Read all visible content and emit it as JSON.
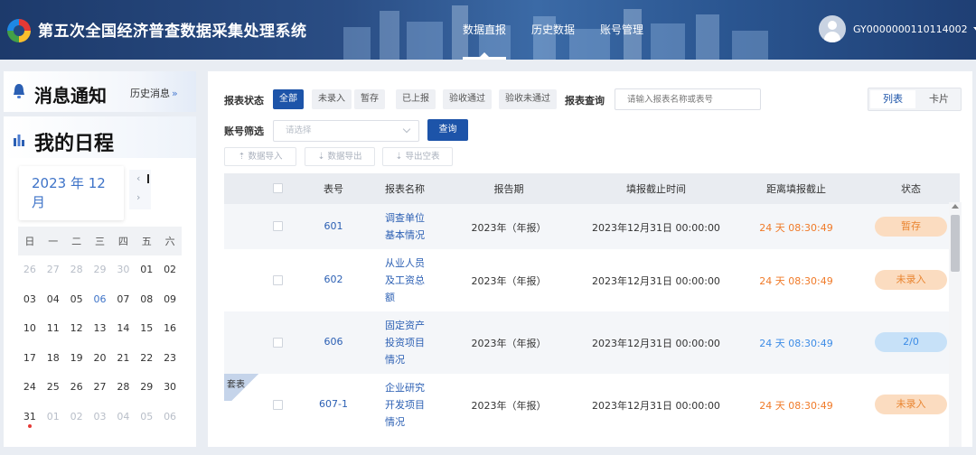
{
  "header": {
    "app_title": "第五次全国经济普查数据采集处理系统",
    "nav": [
      "数据直报",
      "历史数据",
      "账号管理"
    ],
    "active_nav": "数据直报",
    "username": "GY0000000110114002"
  },
  "sidebar": {
    "messages_title": "消息通知",
    "history_link": "历史消息",
    "schedule_title": "我的日程",
    "month_label": "2023 年 12 月",
    "weekdays": [
      "日",
      "一",
      "二",
      "三",
      "四",
      "五",
      "六"
    ],
    "weeks": [
      [
        "26",
        "27",
        "28",
        "29",
        "30",
        "01",
        "02"
      ],
      [
        "03",
        "04",
        "05",
        "06",
        "07",
        "08",
        "09"
      ],
      [
        "10",
        "11",
        "12",
        "13",
        "14",
        "15",
        "16"
      ],
      [
        "17",
        "18",
        "19",
        "20",
        "21",
        "22",
        "23"
      ],
      [
        "24",
        "25",
        "26",
        "27",
        "28",
        "29",
        "30"
      ],
      [
        "31",
        "01",
        "02",
        "03",
        "04",
        "05",
        "06"
      ]
    ],
    "today": "06",
    "event_day": "31"
  },
  "filters": {
    "status_label": "报表状态",
    "status_options": [
      "全部",
      "未录入",
      "暂存",
      "已上报",
      "验收通过",
      "验收未通过"
    ],
    "active_status": "全部",
    "query_label": "报表查询",
    "query_placeholder": "请输入报表名称或表号",
    "view_options": [
      "列表",
      "卡片"
    ],
    "account_label": "账号筛选",
    "account_placeholder": "请选择",
    "query_button": "查询",
    "actions": [
      "数据导入",
      "数据导出",
      "导出空表"
    ]
  },
  "table": {
    "columns": [
      "表号",
      "报表名称",
      "报告期",
      "填报截止时间",
      "距离填报截止",
      "状态"
    ],
    "rows": [
      {
        "code": "601",
        "name_lines": [
          "调查单位",
          "基本情况"
        ],
        "period": "2023年（年报）",
        "deadline": "2023年12月31日 00:00:00",
        "remaining": "24 天 08:30:49",
        "status": "暂存"
      },
      {
        "code": "602",
        "name_lines": [
          "从业人员",
          "及工资总",
          "额"
        ],
        "period": "2023年（年报）",
        "deadline": "2023年12月31日 00:00:00",
        "remaining": "24 天 08:30:49",
        "status": "未录入"
      },
      {
        "code": "606",
        "name_lines": [
          "固定资产",
          "投资项目",
          "情况"
        ],
        "period": "2023年（年报）",
        "deadline": "2023年12月31日 00:00:00",
        "remaining": "24 天 08:30:49",
        "status": "2/0"
      },
      {
        "code": "607-1",
        "name_lines": [
          "企业研究",
          "开发项目",
          "情况"
        ],
        "period": "2023年（年报）",
        "deadline": "2023年12月31日 00:00:00",
        "remaining": "24 天 08:30:49",
        "status": "未录入",
        "corner_tag": "套表"
      }
    ]
  },
  "colors": {
    "primary": "#1d54a9",
    "orange": "#f07a28",
    "sky": "#3d8ce6",
    "header": "#2a4d84"
  }
}
